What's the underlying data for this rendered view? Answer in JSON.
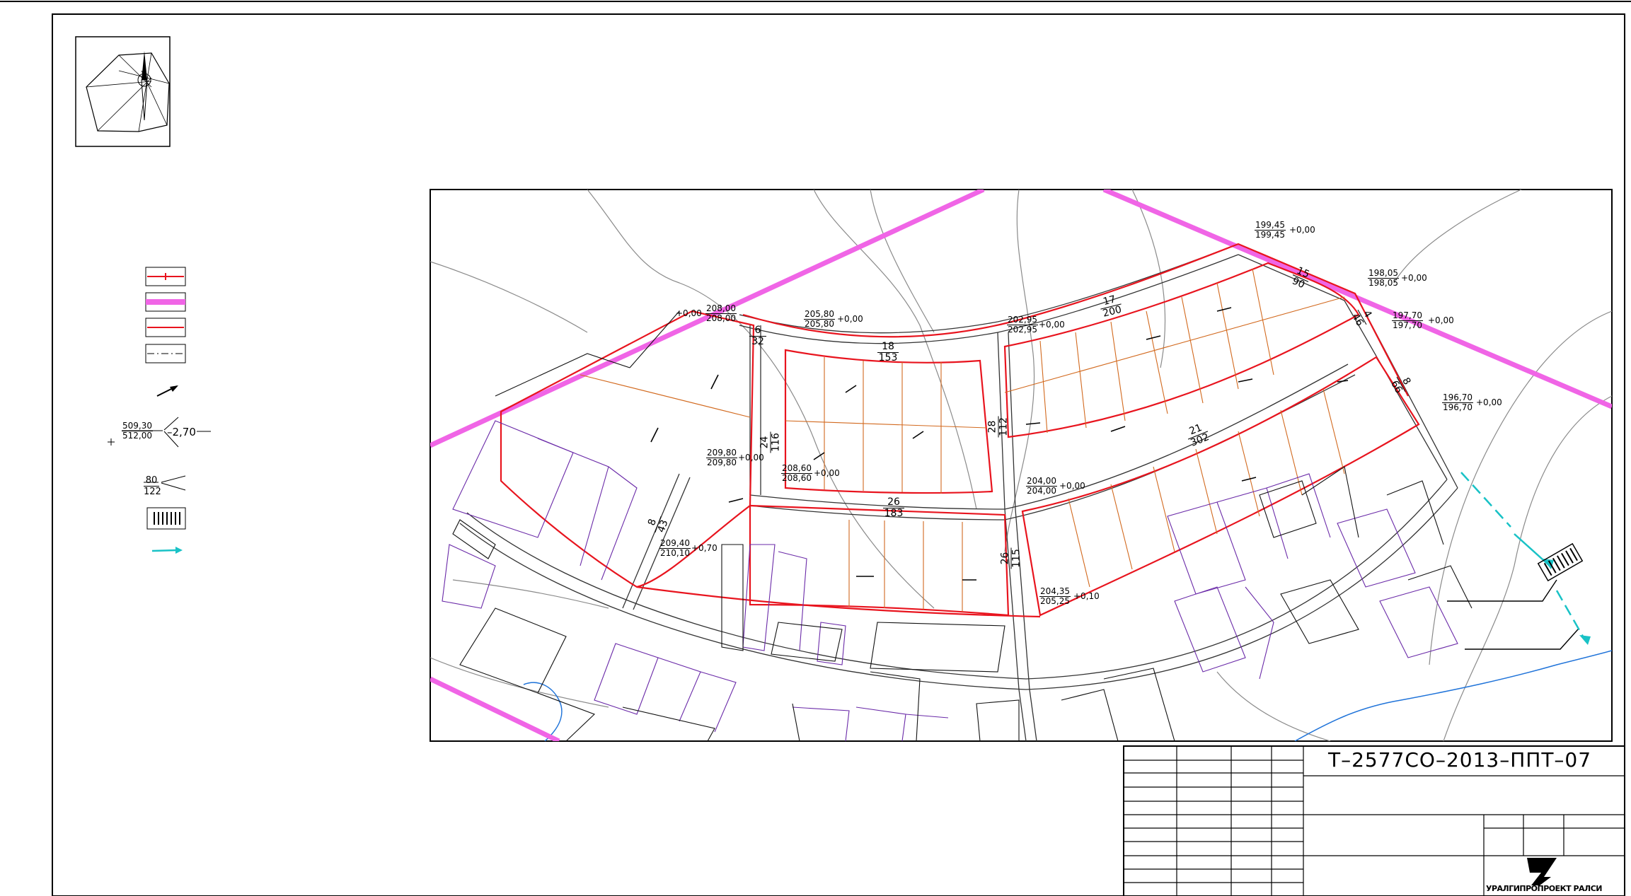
{
  "drawing": {
    "code": "Т–2577СО–2013–ППТ–07",
    "company": "УРАЛГИПРОПРОЕКТ РАЛСИ"
  },
  "legend": {
    "elevation_example": {
      "design": "509,30",
      "existing": "512,00",
      "delta": "–2,70"
    },
    "slope_example": {
      "slope": "80",
      "length": "122"
    }
  },
  "elevations": [
    {
      "design": "199,45",
      "existing": "199,45",
      "delta": "+0,00"
    },
    {
      "design": "198,05",
      "existing": "198,05",
      "delta": "+0,00"
    },
    {
      "design": "197,70",
      "existing": "197,70",
      "delta": "+0,00"
    },
    {
      "design": "196,70",
      "existing": "196,70",
      "delta": "+0,00"
    },
    {
      "design": "208,00",
      "existing": "208,00",
      "delta": "+0,00"
    },
    {
      "design": "205,80",
      "existing": "205,80",
      "delta": "+0,00"
    },
    {
      "design": "202,95",
      "existing": "202,95",
      "delta": "+0,00"
    },
    {
      "design": "209,80",
      "existing": "209,80",
      "delta": "+0,00"
    },
    {
      "design": "208,60",
      "existing": "208,60",
      "delta": "+0,00"
    },
    {
      "design": "204,00",
      "existing": "204,00",
      "delta": "+0,00"
    },
    {
      "design": "209,40",
      "existing": "210,10",
      "delta": "+0,70"
    },
    {
      "design": "204,35",
      "existing": "205,25",
      "delta": "+0,10"
    }
  ],
  "slopes": [
    {
      "slope": "18",
      "length": "153"
    },
    {
      "slope": "17",
      "length": "200"
    },
    {
      "slope": "15",
      "length": "90"
    },
    {
      "slope": "6",
      "length": "32"
    },
    {
      "slope": "26",
      "length": "183"
    },
    {
      "slope": "21",
      "length": "302"
    },
    {
      "slope": "24",
      "length": "116"
    },
    {
      "slope": "28",
      "length": "112"
    },
    {
      "slope": "26",
      "length": "115"
    },
    {
      "slope": "8",
      "length": "43"
    },
    {
      "slope": "8",
      "length": "66"
    },
    {
      "slope": "4",
      "length": "46"
    }
  ],
  "colors": {
    "boundary": "#e8141e",
    "zone": "#f065e6",
    "lot": "#d2691e",
    "building": "#6a2aa8",
    "contour": "#888888",
    "water": "#1f73d9",
    "flow": "#19c2c6"
  }
}
